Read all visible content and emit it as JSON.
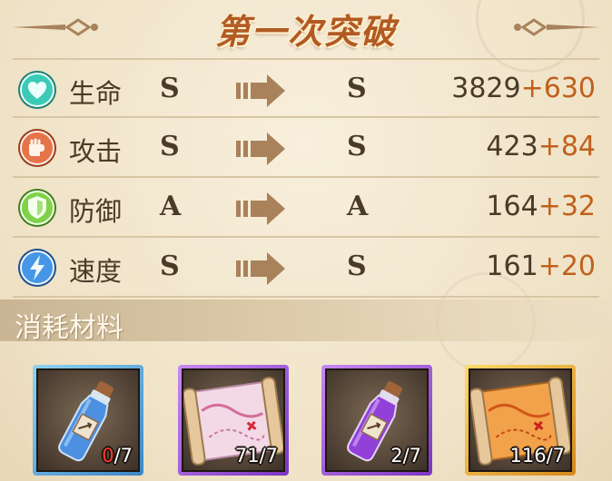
{
  "title": "第一次突破",
  "stats": [
    {
      "name": "生命",
      "icon": "heart-icon",
      "color": "#32b7a6",
      "grade_from": "S",
      "grade_to": "S",
      "base": "3829",
      "bonus": "+630"
    },
    {
      "name": "攻击",
      "icon": "fist-icon",
      "color": "#e0673c",
      "grade_from": "S",
      "grade_to": "S",
      "base": "423",
      "bonus": "+84"
    },
    {
      "name": "防御",
      "icon": "shield-icon",
      "color": "#6cc13b",
      "grade_from": "A",
      "grade_to": "A",
      "base": "164",
      "bonus": "+32"
    },
    {
      "name": "速度",
      "icon": "lightning-icon",
      "color": "#3d8fe0",
      "grade_from": "S",
      "grade_to": "S",
      "base": "161",
      "bonus": "+20"
    }
  ],
  "section_label": "消耗材料",
  "materials": [
    {
      "icon": "blue-potion-icon",
      "rarity_color": "#3b86c8",
      "owned": "0",
      "required": "/7",
      "insufficient": true
    },
    {
      "icon": "pink-map-scroll-icon",
      "rarity_color": "#7b36c2",
      "owned": "71",
      "required": "/7",
      "insufficient": false
    },
    {
      "icon": "purple-potion-icon",
      "rarity_color": "#7b36c2",
      "owned": "2",
      "required": "/7",
      "insufficient": false
    },
    {
      "icon": "orange-map-scroll-icon",
      "rarity_color": "#d58a1c",
      "owned": "116",
      "required": "/7",
      "insufficient": false
    }
  ]
}
